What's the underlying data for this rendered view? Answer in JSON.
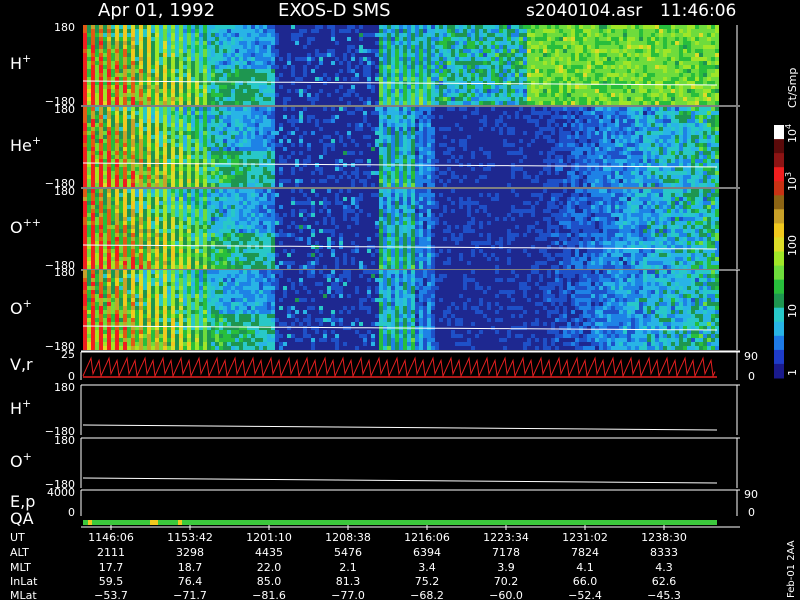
{
  "header": {
    "date": "Apr 01, 1992",
    "instrument": "EXOS-D SMS",
    "file": "s2040104.asr",
    "time": "11:46:06"
  },
  "chart_data": {
    "type": "heatmap",
    "panels": [
      {
        "label": "H",
        "sup": "+",
        "ytop": "180",
        "ybot": "−180"
      },
      {
        "label": "He",
        "sup": "+",
        "ytop": "180",
        "ybot": "−180"
      },
      {
        "label": "O",
        "sup": "++",
        "ytop": "180",
        "ybot": "−180"
      },
      {
        "label": "O",
        "sup": "+",
        "ytop": "180",
        "ybot": "−180"
      }
    ],
    "line_panels": [
      {
        "label": "V,r",
        "sup": "",
        "ytop": "25",
        "ybot": "0",
        "rtop": "90",
        "rbot": "0"
      },
      {
        "label": "H",
        "sup": "+",
        "ytop": "180",
        "ybot": "−180",
        "rtop": "",
        "rbot": ""
      },
      {
        "label": "O",
        "sup": "+",
        "ytop": "180",
        "ybot": "−180",
        "rtop": "",
        "rbot": ""
      },
      {
        "label": "E,p",
        "sup": "",
        "ytop": "4000",
        "ybot": "0",
        "rtop": "90",
        "rbot": "0"
      }
    ],
    "qa_label": "QA",
    "colorbar": {
      "unit": "Ct/Smp",
      "ticks": [
        {
          "base": "10",
          "exp": "4"
        },
        {
          "base": "10",
          "exp": "3"
        },
        {
          "base": "100",
          "exp": ""
        },
        {
          "base": "10",
          "exp": ""
        },
        {
          "base": "1",
          "exp": ""
        }
      ],
      "colors": [
        "#1a1a8c",
        "#1e3cc8",
        "#1e7ae6",
        "#28b4e6",
        "#28c8c8",
        "#1e9650",
        "#28be3c",
        "#6edc3c",
        "#a0e628",
        "#dcdc28",
        "#f0c81e",
        "#c8a028",
        "#8c6414",
        "#c83214",
        "#f01e1e",
        "#8c1414",
        "#5a0a0a",
        "#ffffff"
      ]
    },
    "times": [
      {
        "ut": "1146:06",
        "alt": "2111",
        "mlt": "17.7",
        "inlat": "59.5",
        "mlat": "−53.7"
      },
      {
        "ut": "1153:42",
        "alt": "3298",
        "mlt": "18.7",
        "inlat": "76.4",
        "mlat": "−71.7"
      },
      {
        "ut": "1201:10",
        "alt": "4435",
        "mlt": "22.0",
        "inlat": "85.0",
        "mlat": "−81.6"
      },
      {
        "ut": "1208:38",
        "alt": "5476",
        "mlt": "2.1",
        "inlat": "81.3",
        "mlat": "−77.0"
      },
      {
        "ut": "1216:06",
        "alt": "6394",
        "mlt": "3.4",
        "inlat": "75.2",
        "mlat": "−68.2"
      },
      {
        "ut": "1223:34",
        "alt": "7178",
        "mlt": "3.9",
        "inlat": "70.2",
        "mlat": "−60.0"
      },
      {
        "ut": "1231:02",
        "alt": "7824",
        "mlt": "4.1",
        "inlat": "66.0",
        "mlat": "−52.4"
      },
      {
        "ut": "1238:30",
        "alt": "8333",
        "mlt": "4.3",
        "inlat": "62.6",
        "mlat": "−45.3"
      }
    ],
    "row_labels": {
      "ut": "UT",
      "alt": "ALT",
      "mlt": "MLT",
      "inlat": "InLat",
      "mlat": "MLat"
    }
  },
  "footer_note": "Feb-01 2AA"
}
